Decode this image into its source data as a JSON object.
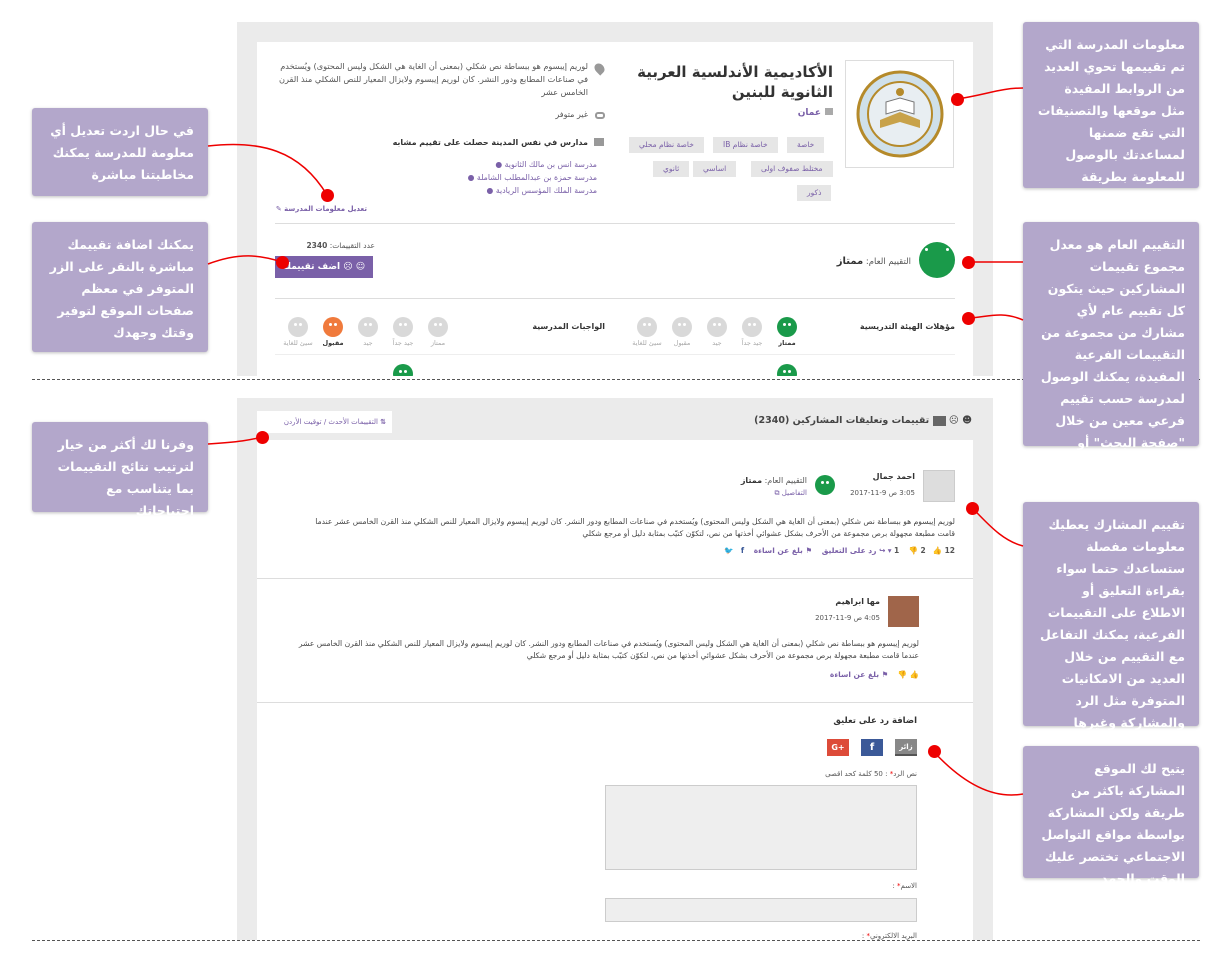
{
  "school": {
    "name_line1": "الأكاديمية الأندلسية العربية",
    "name_line2": "الثانوية للبنين",
    "city": "عمان",
    "description": "لوريم إيبسوم هو ببساطة نص شكلي (بمعنى أن الغاية هي الشكل وليس المحتوى) ويُستخدم في صناعات المطابع ودور النشر. كان لوريم إيبسوم ولايزال المعيار للنص الشكلي منذ القرن الخامس عشر",
    "phone": "غير متوفر",
    "similar_title": "مدارس في نفس المدينة حصلت على تقييم مشابه",
    "similar": [
      "مدرسة انس بن مالك الثانوية",
      "مدرسة حمزة بن عبدالمطلب الشاملة",
      "مدرسة الملك المؤسس الريادية"
    ],
    "edit_link": "تعديل معلومات المدرسة",
    "tags": [
      "خاصة",
      "خاصة نظام IB",
      "خاصة نظام محلي",
      "مختلط صفوف اولى",
      "اساسي",
      "ثانوي",
      "ذكور"
    ]
  },
  "rating": {
    "overall_label": "التقييم العام:",
    "overall_value": "ممتاز",
    "count_label": "عدد التقييمات:",
    "count": "2340",
    "add_button": "اضف تقييمك",
    "criteria1": "مؤهلات الهيئة التدريسية",
    "criteria2": "الواجبات المدرسية",
    "scale": [
      "ممتاز",
      "جيد جداً",
      "جيد",
      "مقبول",
      "سيئ للغاية"
    ]
  },
  "reviews": {
    "title": "تقييمات وتعليقات المشاركين",
    "count": "(2340)",
    "sort_label": "التقييمات الأحدث / توقيت الأردن",
    "r1": {
      "name": "احمد جمال",
      "date": "3:05 ص 9-11-2017",
      "overall_label": "التقييم العام:",
      "overall_value": "ممتاز",
      "details": "التفاصيل",
      "text": "لوريم إيبسوم هو ببساطة نص شكلي (بمعنى أن الغاية هي الشكل وليس المحتوى) ويُستخدم في صناعات المطابع ودور النشر. كان لوريم إيبسوم ولايزال المعيار للنص الشكلي منذ القرن الخامس عشر عندما قامت مطبعة مجهولة برص مجموعة من الأحرف بشكل عشوائي أخذتها من نص، لتكوّن كتيّب بمثابة دليل أو مرجع شكلي",
      "likes": "12",
      "dislikes": "2",
      "replies": "1",
      "reply_label": "رد على التعليق",
      "report": "بلغ عن اساءة"
    },
    "r2": {
      "name": "مها ابراهيم",
      "date": "4:05 ص 9-11-2017",
      "text": "لوريم إيبسوم هو ببساطة نص شكلي (بمعنى أن الغاية هي الشكل وليس المحتوى) ويُستخدم في صناعات المطابع ودور النشر. كان لوريم إيبسوم ولايزال المعيار للنص الشكلي منذ القرن الخامس عشر عندما قامت مطبعة مجهولة برص مجموعة من الأحرف بشكل عشوائي أخذتها من نص، لتكوّن كتيّب بمثابة دليل أو مرجع شكلي",
      "report": "بلغ عن اساءة"
    },
    "reply_form": {
      "title": "اضافة رد على تعليق",
      "visitor": "زائر",
      "text_label": "نص الرد",
      "text_hint": ": 50 كلمة كحد اقصى",
      "name_label": "الاسم",
      "email_label": "البريد الالكتروني"
    }
  },
  "callouts": {
    "c1": "معلومات المدرسة التي تم تقييمها تحوي العديد من الروابط المفيدة مثل موقعها والتصنيفات التي تقع ضمنها لمساعدتك بالوصول للمعلومة بطريقة ميسرة",
    "c2": "في حال اردت تعديل أي معلومة للمدرسة يمكنك مخاطبتنا مباشرة",
    "c3": "التقييم العام هو معدل مجموع تقييمات المشاركين حيث يتكون كل تقييم عام لأي مشارك من مجموعة من التقييمات الفرعية المفيدة، يمكنك الوصول لمدرسة حسب تقييم فرعي معين من خلال \"صفحة البحث\" أو بالنقر على \"تصفح\"",
    "c4": "يمكنك اضافة تقييمك مباشرة بالنقر على الزر المتوفر في معظم صفحات الموقع لتوفير وقتك وجهدك",
    "c5": "وفرنا لك أكثر من خيار لترتيب نتائج التقييمات بما يتناسب مع احتياجاتك",
    "c6": "تقييم المشارك يعطيك معلومات مفصلة ستساعدك حتما سواء بقراءة التعليق أو الاطلاع على التقييمات الفرعية، يمكنك التفاعل مع التقييم من خلال العديد من الامكانيات المتوفرة مثل الرد والمشاركة وغيرها",
    "c7": "يتيح لك الموقع المشاركة باكثر من طريقة ولكن المشاركة بواسطة مواقع التواصل الاجتماعي تختصر عليك الوقت والجهد"
  },
  "colors": {
    "accent": "#7a60a8",
    "callout": "#b3a7cb",
    "green": "#1a9a4a",
    "red": "#e00000"
  }
}
